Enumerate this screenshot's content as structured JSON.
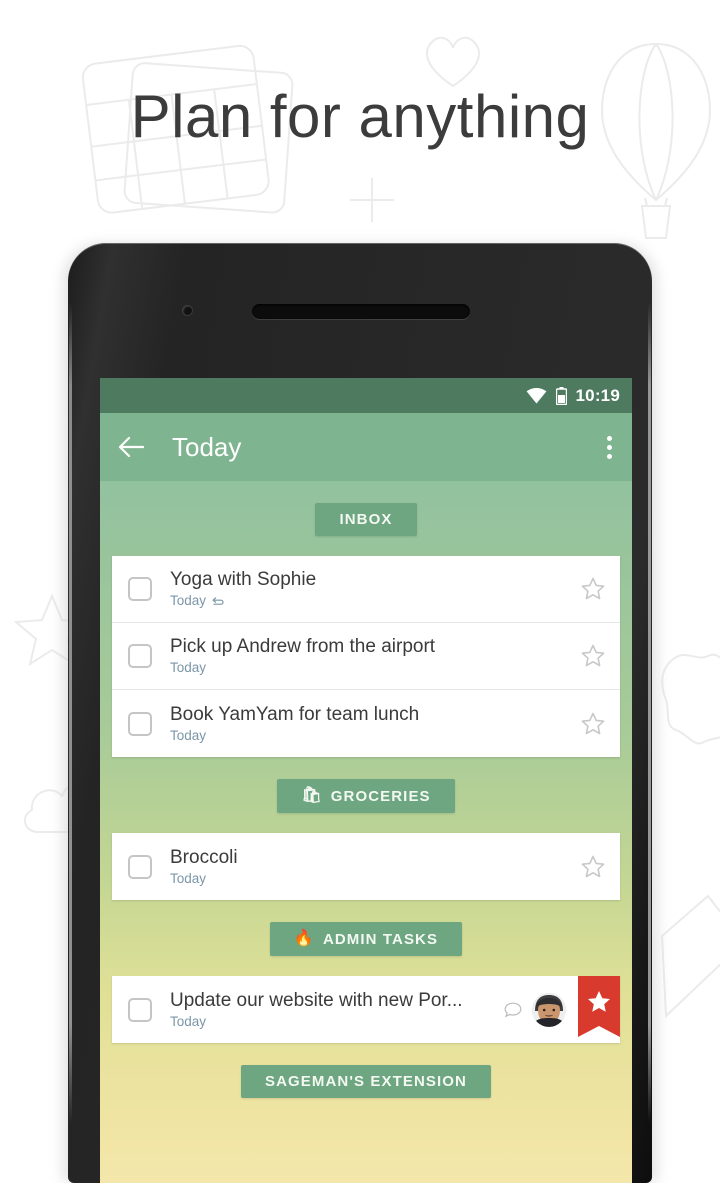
{
  "headline": "Plan for anything",
  "device": {
    "camera_icon": "front-camera",
    "speaker_icon": "earpiece-speaker"
  },
  "status_bar": {
    "wifi_icon": "wifi-icon",
    "battery_icon": "battery-icon",
    "time": "10:19",
    "background": "#4e7b60"
  },
  "app_bar": {
    "back_icon": "back-arrow-icon",
    "title": "Today",
    "overflow_icon": "overflow-menu-icon",
    "background": "#7fb490"
  },
  "colors": {
    "chip_background": "#6da681",
    "accent_red": "#d83b2d",
    "date_text": "#7b96a8",
    "gradient_top": "#8fc19d",
    "gradient_bottom": "#f4e7ab"
  },
  "sections": [
    {
      "chip_label": "INBOX",
      "chip_emoji": "",
      "chip_icon_name": "",
      "tasks": [
        {
          "title": "Yoga with Sophie",
          "date": "Today",
          "repeat": true,
          "starred": false,
          "has_comment": false,
          "has_avatar": false,
          "has_flag": false
        },
        {
          "title": "Pick up Andrew from the airport",
          "date": "Today",
          "repeat": false,
          "starred": false,
          "has_comment": false,
          "has_avatar": false,
          "has_flag": false
        },
        {
          "title": "Book YamYam for team lunch",
          "date": "Today",
          "repeat": false,
          "starred": false,
          "has_comment": false,
          "has_avatar": false,
          "has_flag": false
        }
      ]
    },
    {
      "chip_label": "GROCERIES",
      "chip_emoji": "🛍",
      "chip_icon_name": "shopping-bag-icon",
      "tasks": [
        {
          "title": "Broccoli",
          "date": "Today",
          "repeat": false,
          "starred": false,
          "has_comment": false,
          "has_avatar": false,
          "has_flag": false
        }
      ]
    },
    {
      "chip_label": "ADMIN TASKS",
      "chip_emoji": "🔥",
      "chip_icon_name": "flame-icon",
      "tasks": [
        {
          "title": "Update our website with new Por...",
          "date": "Today",
          "repeat": false,
          "starred": false,
          "has_comment": true,
          "has_avatar": true,
          "has_flag": true
        }
      ]
    },
    {
      "chip_label": "SAGEMAN'S EXTENSION",
      "chip_emoji": "",
      "chip_icon_name": "",
      "tasks": []
    }
  ]
}
